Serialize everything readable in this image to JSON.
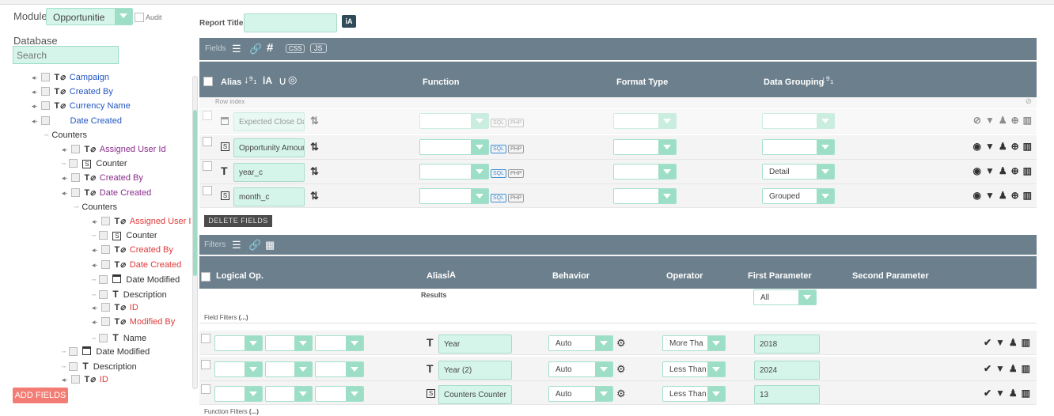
{
  "sidebar": {
    "module_label": "Module",
    "module_value": "Opportunitie",
    "audit_label": "Audit",
    "database_label": "Database",
    "search_placeholder": "Search",
    "add_fields": "ADD FIELDS",
    "tree": [
      {
        "text": "Campaign",
        "color": "blue",
        "icon": "T⊘"
      },
      {
        "text": "Created By",
        "color": "blue",
        "icon": "T⊘"
      },
      {
        "text": "Currency Name",
        "color": "blue",
        "icon": "T⊘"
      },
      {
        "text": "Date Created",
        "color": "blue",
        "icon": ""
      },
      {
        "text": "Counters",
        "color": "blk",
        "icon": ""
      },
      {
        "text": "Assigned User Id",
        "color": "purple",
        "icon": "T⊘"
      },
      {
        "text": "Counter",
        "color": "blk",
        "icon": "S"
      },
      {
        "text": "Created By",
        "color": "purple",
        "icon": "T⊘"
      },
      {
        "text": "Date Created",
        "color": "purple",
        "icon": "T⊘"
      },
      {
        "text": "Counters",
        "color": "blk",
        "icon": ""
      },
      {
        "text": "Assigned User Id",
        "color": "red",
        "icon": "T⊘"
      },
      {
        "text": "Counter",
        "color": "blk",
        "icon": "S"
      },
      {
        "text": "Created By",
        "color": "red",
        "icon": "T⊘"
      },
      {
        "text": "Date Created",
        "color": "red",
        "icon": "T⊘"
      },
      {
        "text": "Date Modified",
        "color": "blk",
        "icon": "cal"
      },
      {
        "text": "Description",
        "color": "blk",
        "icon": "T"
      },
      {
        "text": "ID",
        "color": "red",
        "icon": "T⊘"
      },
      {
        "text": "Modified By",
        "color": "red",
        "icon": "T⊘"
      },
      {
        "text": "Name",
        "color": "blk",
        "icon": "T"
      },
      {
        "text": "Date Modified",
        "color": "blk",
        "icon": "cal"
      },
      {
        "text": "Description",
        "color": "blk",
        "icon": "T"
      },
      {
        "text": "ID",
        "color": "red",
        "icon": "T⊘"
      }
    ]
  },
  "report_title_label": "Report Title:",
  "fields": {
    "section_label": "Fields",
    "css": "CSS",
    "js": "JS",
    "col_alias": "Alias",
    "col_function": "Function",
    "col_format": "Format Type",
    "col_grouping": "Data Grouping",
    "row_index": "Row index",
    "sql": "SQL",
    "php": "PHP",
    "rows": [
      {
        "alias": "Expected Close Date",
        "type": "cal",
        "grouping": ""
      },
      {
        "alias": "Opportunity Amount",
        "type": "S",
        "grouping": ""
      },
      {
        "alias": "year_c",
        "type": "T",
        "grouping": "Detail"
      },
      {
        "alias": "month_c",
        "type": "S",
        "grouping": "Grouped"
      }
    ],
    "delete_fields": "DELETE FIELDS"
  },
  "filters": {
    "section_label": "Filters",
    "col_logical": "Logical Op.",
    "col_alias": "Alias",
    "col_behavior": "Behavior",
    "col_operator": "Operator",
    "col_first": "First Parameter",
    "col_second": "Second Parameter",
    "results_label": "Results",
    "results_value": "All",
    "field_filters": "Field Filters",
    "function_filters": "Function Filters",
    "rows": [
      {
        "type": "T",
        "alias": "Year",
        "behavior": "Auto",
        "operator": "More Tha",
        "first": "2018"
      },
      {
        "type": "T",
        "alias": "Year (2)",
        "behavior": "Auto",
        "operator": "Less Than",
        "first": "2024"
      },
      {
        "type": "S",
        "alias": "Counters Counter",
        "behavior": "Auto",
        "operator": "Less Than",
        "first": "13"
      }
    ]
  }
}
